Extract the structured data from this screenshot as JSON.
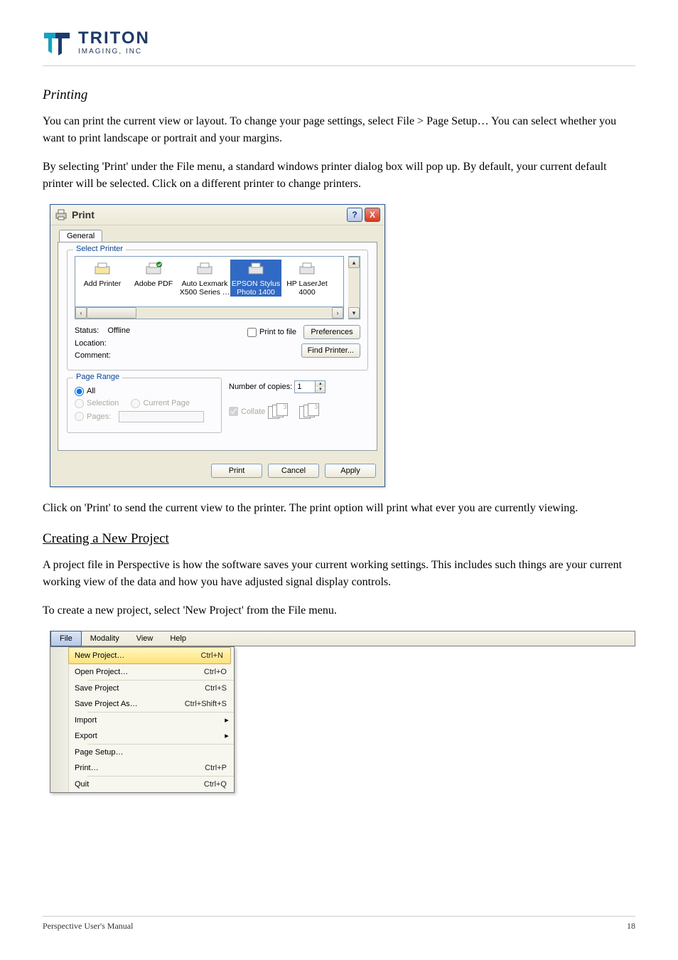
{
  "logo": {
    "main": "TRITON",
    "sub": "IMAGING, INC"
  },
  "sections": {
    "print_title": "Printing",
    "print_p1": "You can print the current view or layout.  To change your page settings, select File > Page Setup…  You can select whether you want to print landscape or portrait and your margins.",
    "print_p2": "By selecting 'Print' under the File menu, a standard windows printer dialog box will pop up.  By default, your current default printer will be selected.  Click on a different printer to change printers.",
    "print_p3": "Click on 'Print' to send the current view to the printer.  The print option will print what ever you are currently viewing.",
    "new_title": "Creating a New Project",
    "new_p1": "A project file in Perspective is how the software saves your current working settings.  This includes such things are your current working view of the data and how you have adjusted signal display controls.",
    "new_p2": "To create a new project, select 'New Project' from the File menu."
  },
  "print_dialog": {
    "title": "Print",
    "tab": "General",
    "select_printer": "Select Printer",
    "printers": [
      {
        "label": "Add Printer"
      },
      {
        "label": "Adobe PDF"
      },
      {
        "label": "Auto Lexmark X500 Series …"
      },
      {
        "label": "EPSON Stylus Photo 1400"
      },
      {
        "label": "HP LaserJet 4000"
      }
    ],
    "selected_printer_index": 3,
    "status_label": "Status:",
    "status_value": "Offline",
    "location_label": "Location:",
    "comment_label": "Comment:",
    "print_to_file": "Print to file",
    "preferences": "Preferences",
    "find_printer": "Find Printer...",
    "page_range": "Page Range",
    "all": "All",
    "selection": "Selection",
    "current_page": "Current Page",
    "pages": "Pages:",
    "copies_label": "Number of copies:",
    "copies_value": "1",
    "collate": "Collate",
    "btn_print": "Print",
    "btn_cancel": "Cancel",
    "btn_apply": "Apply"
  },
  "file_menu": {
    "bar": [
      "File",
      "Modality",
      "View",
      "Help"
    ],
    "items": [
      {
        "label": "New Project…",
        "shortcut": "Ctrl+N",
        "highlight": true
      },
      {
        "label": "Open Project…",
        "shortcut": "Ctrl+O"
      },
      {
        "sep": true
      },
      {
        "label": "Save Project",
        "shortcut": "Ctrl+S"
      },
      {
        "label": "Save Project As…",
        "shortcut": "Ctrl+Shift+S"
      },
      {
        "sep": true
      },
      {
        "label": "Import",
        "submenu": true
      },
      {
        "label": "Export",
        "submenu": true
      },
      {
        "sep": true
      },
      {
        "label": "Page Setup…"
      },
      {
        "label": "Print…",
        "shortcut": "Ctrl+P"
      },
      {
        "sep": true
      },
      {
        "label": "Quit",
        "shortcut": "Ctrl+Q"
      }
    ]
  },
  "footer": {
    "left": "Perspective User's Manual",
    "right": "18"
  }
}
